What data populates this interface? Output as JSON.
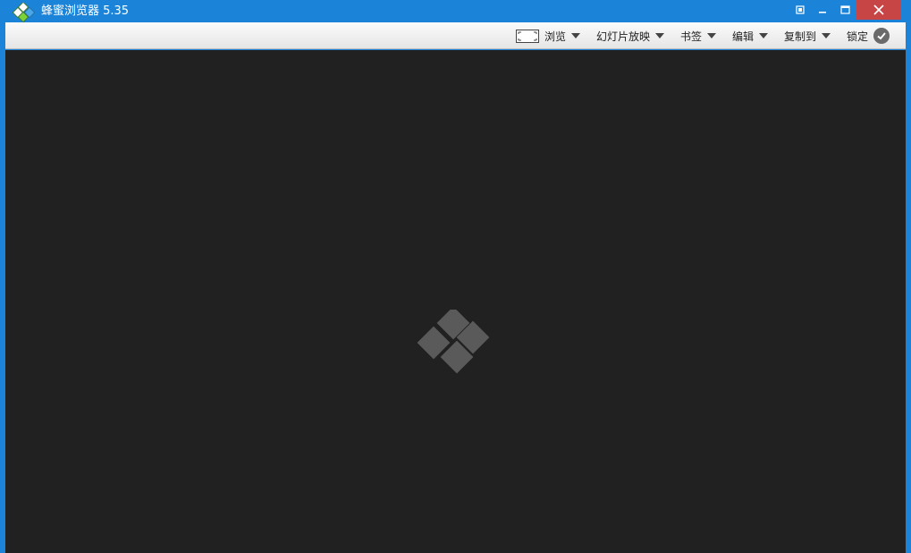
{
  "window": {
    "title": "蜂蜜浏览器 5.35",
    "accent": "#1c84d8",
    "close_color": "#c84546"
  },
  "titlebar_icons": [
    "app-logo-icon",
    "fit-window-icon",
    "minimize-icon",
    "maximize-icon",
    "close-icon"
  ],
  "toolbar": {
    "browse_label": "浏览",
    "slideshow_label": "幻灯片放映",
    "bookmarks_label": "书签",
    "edit_label": "编辑",
    "copy_to_label": "复制到",
    "lock_label": "锁定"
  },
  "main": {
    "background": "#212121",
    "placeholder_icon": "honeyview-logo-icon"
  }
}
